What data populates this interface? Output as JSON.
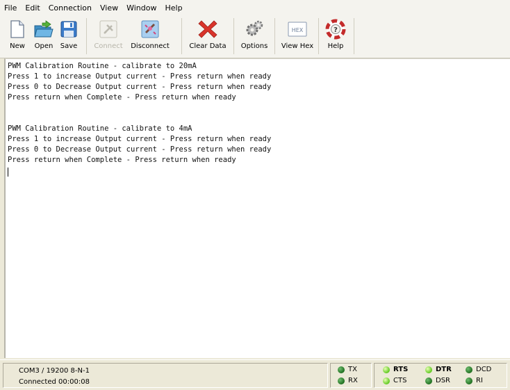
{
  "menu": [
    "File",
    "Edit",
    "Connection",
    "View",
    "Window",
    "Help"
  ],
  "toolbar": {
    "new": "New",
    "open": "Open",
    "save": "Save",
    "connect": "Connect",
    "disconnect": "Disconnect",
    "clear": "Clear Data",
    "options": "Options",
    "viewhex": "View Hex",
    "help": "Help",
    "hex_icon_text": "HEX"
  },
  "terminal_lines": [
    "PWM Calibration Routine - calibrate to 20mA",
    "Press 1 to increase Output current - Press return when ready",
    "Press 0 to Decrease Output current - Press return when ready",
    "Press return when Complete - Press return when ready",
    "",
    "",
    "PWM Calibration Routine - calibrate to 4mA",
    "Press 1 to increase Output current - Press return when ready",
    "Press 0 to Decrease Output current - Press return when ready",
    "Press return when Complete - Press return when ready"
  ],
  "status": {
    "port": "COM3 / 19200 8-N-1",
    "connected": "Connected 00:00:08",
    "tx": "TX",
    "rx": "RX",
    "rts": "RTS",
    "cts": "CTS",
    "dtr": "DTR",
    "dsr": "DSR",
    "dcd": "DCD",
    "ri": "RI"
  },
  "colors": {
    "led_dark": "#2e8b2e",
    "led_bright": "#7fd62a",
    "clear_x": "#d9342b"
  }
}
